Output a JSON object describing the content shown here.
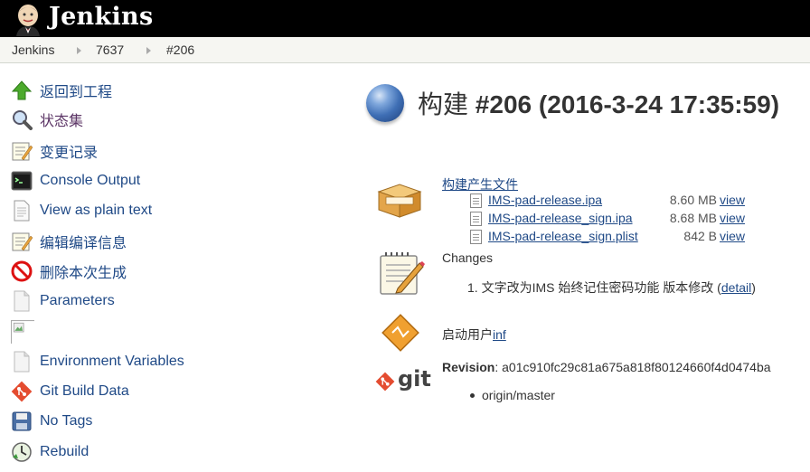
{
  "header": {
    "brand": "Jenkins",
    "logo_icon": "jenkins-butler-icon",
    "bg_color": "#000000"
  },
  "breadcrumb": [
    {
      "label": "Jenkins"
    },
    {
      "label": "7637"
    },
    {
      "label": "#206"
    }
  ],
  "sidebar": {
    "items": [
      {
        "label": "返回到工程",
        "icon": "up-arrow-icon"
      },
      {
        "label": "状态集",
        "icon": "search-icon"
      },
      {
        "label": "变更记录",
        "icon": "notepad-icon"
      },
      {
        "label": "Console Output",
        "icon": "terminal-icon"
      },
      {
        "label": "View as plain text",
        "icon": "document-icon"
      },
      {
        "label": "编辑编译信息",
        "icon": "notepad-icon"
      },
      {
        "label": "删除本次生成",
        "icon": "no-entry-icon"
      },
      {
        "label": "Parameters",
        "icon": "document-icon"
      },
      {
        "label": "",
        "icon": "broken-image-icon"
      },
      {
        "label": "Environment Variables",
        "icon": "document-icon"
      },
      {
        "label": "Git Build Data",
        "icon": "git-icon"
      },
      {
        "label": "No Tags",
        "icon": "save-icon"
      },
      {
        "label": "Rebuild",
        "icon": "clock-icon"
      }
    ]
  },
  "main": {
    "title_prefix": "构建",
    "title_build": "#206 (2016-3-24 17:35:59)",
    "status_icon": "blue-ball-icon",
    "artifacts": {
      "heading": "构建产生文件",
      "files": [
        {
          "name": "IMS-pad-release.ipa",
          "size": "8.60 MB",
          "view": "view"
        },
        {
          "name": "IMS-pad-release_sign.ipa",
          "size": "8.68 MB",
          "view": "view"
        },
        {
          "name": "IMS-pad-release_sign.plist",
          "size": "842 B",
          "view": "view"
        }
      ]
    },
    "changes": {
      "heading": "Changes",
      "item_number": "1.",
      "item_text": "文字改为IMS 始终记住密码功能 版本修改 (",
      "item_link": "detail",
      "item_close": ")"
    },
    "user": {
      "prefix": "启动用户",
      "name": "inf"
    },
    "git": {
      "logo_text": "git",
      "revision_label": "Revision",
      "revision_value": ": a01c910fc29c81a675a818f80124660f4d0474ba",
      "branch": "origin/master"
    }
  }
}
